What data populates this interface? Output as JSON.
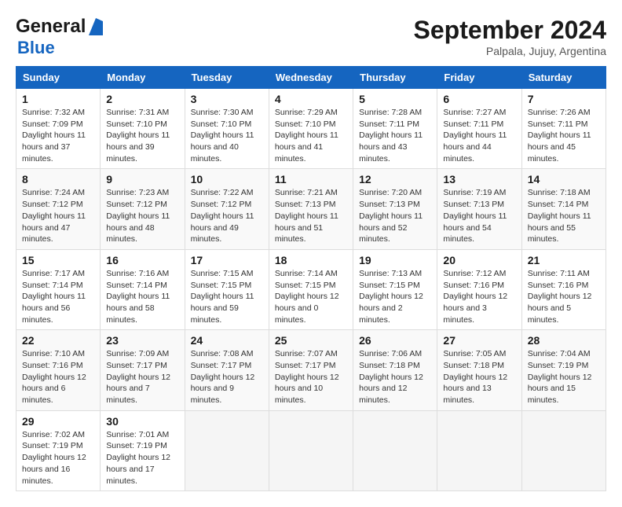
{
  "header": {
    "logo_general": "General",
    "logo_blue": "Blue",
    "month_year": "September 2024",
    "location": "Palpala, Jujuy, Argentina"
  },
  "days_of_week": [
    "Sunday",
    "Monday",
    "Tuesday",
    "Wednesday",
    "Thursday",
    "Friday",
    "Saturday"
  ],
  "weeks": [
    [
      {
        "day": "1",
        "sunrise": "7:32 AM",
        "sunset": "7:09 PM",
        "daylight": "11 hours and 37 minutes."
      },
      {
        "day": "2",
        "sunrise": "7:31 AM",
        "sunset": "7:10 PM",
        "daylight": "11 hours and 39 minutes."
      },
      {
        "day": "3",
        "sunrise": "7:30 AM",
        "sunset": "7:10 PM",
        "daylight": "11 hours and 40 minutes."
      },
      {
        "day": "4",
        "sunrise": "7:29 AM",
        "sunset": "7:10 PM",
        "daylight": "11 hours and 41 minutes."
      },
      {
        "day": "5",
        "sunrise": "7:28 AM",
        "sunset": "7:11 PM",
        "daylight": "11 hours and 43 minutes."
      },
      {
        "day": "6",
        "sunrise": "7:27 AM",
        "sunset": "7:11 PM",
        "daylight": "11 hours and 44 minutes."
      },
      {
        "day": "7",
        "sunrise": "7:26 AM",
        "sunset": "7:11 PM",
        "daylight": "11 hours and 45 minutes."
      }
    ],
    [
      {
        "day": "8",
        "sunrise": "7:24 AM",
        "sunset": "7:12 PM",
        "daylight": "11 hours and 47 minutes."
      },
      {
        "day": "9",
        "sunrise": "7:23 AM",
        "sunset": "7:12 PM",
        "daylight": "11 hours and 48 minutes."
      },
      {
        "day": "10",
        "sunrise": "7:22 AM",
        "sunset": "7:12 PM",
        "daylight": "11 hours and 49 minutes."
      },
      {
        "day": "11",
        "sunrise": "7:21 AM",
        "sunset": "7:13 PM",
        "daylight": "11 hours and 51 minutes."
      },
      {
        "day": "12",
        "sunrise": "7:20 AM",
        "sunset": "7:13 PM",
        "daylight": "11 hours and 52 minutes."
      },
      {
        "day": "13",
        "sunrise": "7:19 AM",
        "sunset": "7:13 PM",
        "daylight": "11 hours and 54 minutes."
      },
      {
        "day": "14",
        "sunrise": "7:18 AM",
        "sunset": "7:14 PM",
        "daylight": "11 hours and 55 minutes."
      }
    ],
    [
      {
        "day": "15",
        "sunrise": "7:17 AM",
        "sunset": "7:14 PM",
        "daylight": "11 hours and 56 minutes."
      },
      {
        "day": "16",
        "sunrise": "7:16 AM",
        "sunset": "7:14 PM",
        "daylight": "11 hours and 58 minutes."
      },
      {
        "day": "17",
        "sunrise": "7:15 AM",
        "sunset": "7:15 PM",
        "daylight": "11 hours and 59 minutes."
      },
      {
        "day": "18",
        "sunrise": "7:14 AM",
        "sunset": "7:15 PM",
        "daylight": "12 hours and 0 minutes."
      },
      {
        "day": "19",
        "sunrise": "7:13 AM",
        "sunset": "7:15 PM",
        "daylight": "12 hours and 2 minutes."
      },
      {
        "day": "20",
        "sunrise": "7:12 AM",
        "sunset": "7:16 PM",
        "daylight": "12 hours and 3 minutes."
      },
      {
        "day": "21",
        "sunrise": "7:11 AM",
        "sunset": "7:16 PM",
        "daylight": "12 hours and 5 minutes."
      }
    ],
    [
      {
        "day": "22",
        "sunrise": "7:10 AM",
        "sunset": "7:16 PM",
        "daylight": "12 hours and 6 minutes."
      },
      {
        "day": "23",
        "sunrise": "7:09 AM",
        "sunset": "7:17 PM",
        "daylight": "12 hours and 7 minutes."
      },
      {
        "day": "24",
        "sunrise": "7:08 AM",
        "sunset": "7:17 PM",
        "daylight": "12 hours and 9 minutes."
      },
      {
        "day": "25",
        "sunrise": "7:07 AM",
        "sunset": "7:17 PM",
        "daylight": "12 hours and 10 minutes."
      },
      {
        "day": "26",
        "sunrise": "7:06 AM",
        "sunset": "7:18 PM",
        "daylight": "12 hours and 12 minutes."
      },
      {
        "day": "27",
        "sunrise": "7:05 AM",
        "sunset": "7:18 PM",
        "daylight": "12 hours and 13 minutes."
      },
      {
        "day": "28",
        "sunrise": "7:04 AM",
        "sunset": "7:19 PM",
        "daylight": "12 hours and 15 minutes."
      }
    ],
    [
      {
        "day": "29",
        "sunrise": "7:02 AM",
        "sunset": "7:19 PM",
        "daylight": "12 hours and 16 minutes."
      },
      {
        "day": "30",
        "sunrise": "7:01 AM",
        "sunset": "7:19 PM",
        "daylight": "12 hours and 17 minutes."
      },
      null,
      null,
      null,
      null,
      null
    ]
  ]
}
